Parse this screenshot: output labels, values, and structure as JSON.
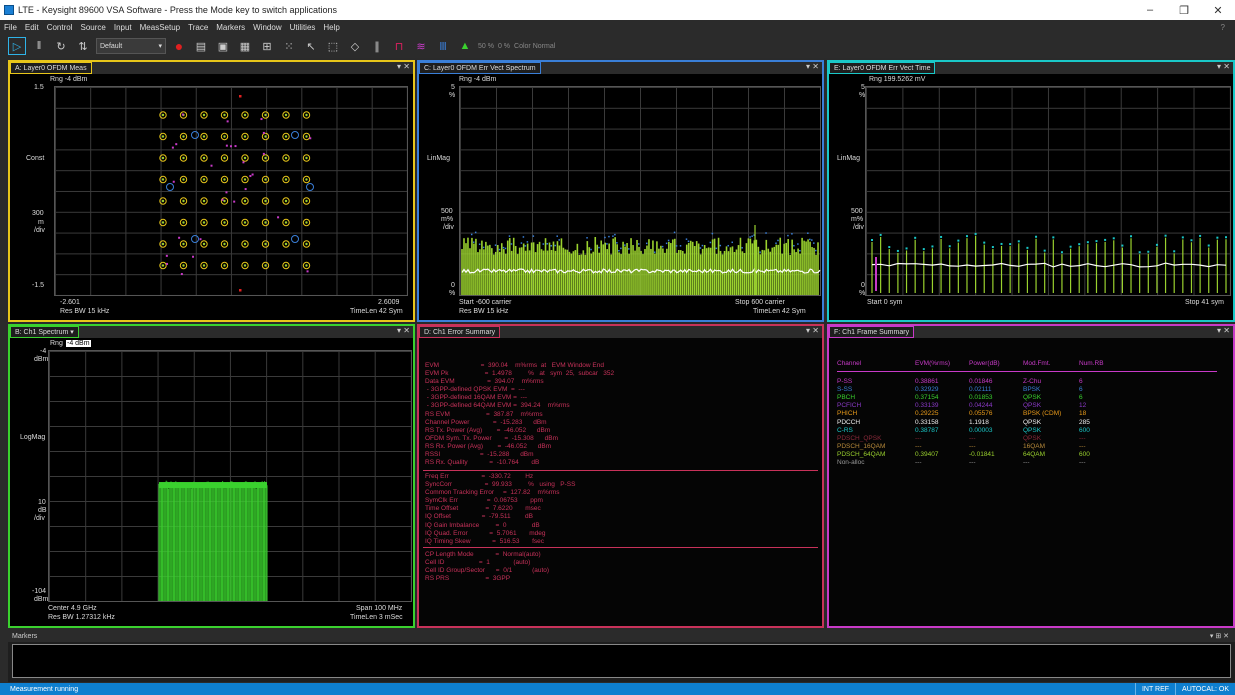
{
  "window": {
    "title": "LTE - Keysight 89600 VSA Software - Press the Mode key to switch applications",
    "minimize": "–",
    "maximize": "❐",
    "close": "✕"
  },
  "menu": [
    "File",
    "Edit",
    "Control",
    "Source",
    "Input",
    "MeasSetup",
    "Trace",
    "Markers",
    "Window",
    "Utilities",
    "Help"
  ],
  "help_mark": "?",
  "toolbar": {
    "preset": "Default",
    "pct1": "50 %",
    "pct2": "0 %",
    "color_mode": "Color Normal"
  },
  "paneA": {
    "title": "A: Layer0 OFDM Meas",
    "rng": "Rng -4 dBm",
    "top": "1.5",
    "mid_label": "Const",
    "scale": [
      "300",
      "m",
      "/div"
    ],
    "bottom": "-1.5",
    "x_start": "-2.601",
    "x_stop": "2.6009",
    "res_bw": "Res BW 15 kHz",
    "timelen": "TimeLen 42  Sym",
    "color": "#e8c61a"
  },
  "paneC": {
    "title": "C: Layer0 OFDM Err Vect Spectrum",
    "rng": "Rng -4 dBm",
    "top": [
      "5",
      "%"
    ],
    "mid_label": "LinMag",
    "scale": [
      "500",
      "m%",
      "/div"
    ],
    "bottom": [
      "0",
      "%"
    ],
    "x_start": "Start -600  carrier",
    "x_stop": "Stop 600  carrier",
    "res_bw": "Res BW 15 kHz",
    "timelen": "TimeLen 42  Sym",
    "color": "#3a7fd8"
  },
  "paneE": {
    "title": "E: Layer0 OFDM Err Vect Time",
    "rng": "Rng 199.5262 mV",
    "top": [
      "5",
      "%"
    ],
    "mid_label": "LinMag",
    "scale": [
      "500",
      "m%",
      "/div"
    ],
    "bottom": [
      "0",
      "%"
    ],
    "x_start": "Start 0  sym",
    "x_stop": "Stop 41  sym",
    "color": "#1ac8c8"
  },
  "paneB": {
    "title": "B: Ch1 Spectrum",
    "rng_prefix": "Rng ",
    "rng_value": "-4 dBm",
    "top": [
      "-4",
      "dBm"
    ],
    "mid_label": "LogMag",
    "scale": [
      "10",
      "dB",
      "/div"
    ],
    "bottom": [
      "-104",
      "dBm"
    ],
    "center": "Center 4.9 GHz",
    "span": "Span 100 MHz",
    "res_bw": "Res BW 1.27312 kHz",
    "timelen": "TimeLen 3 mSec",
    "color": "#3ad12e"
  },
  "paneD": {
    "title": "D: Ch1 Error Summary",
    "color": "#c8325a",
    "lines": [
      "EVM                       =  390.04    m%rms  at   EVM Window End",
      "EVM Pk                    =  1.4978         %   at   sym  25,  subcar   352",
      "Data EVM                  =  394.07    m%rms",
      " - 3GPP-defined QPSK EVM  =  ---",
      " - 3GPP-defined 16QAM EVM =  ---",
      " - 3GPP-defined 64QAM EVM =  394.24    m%rms",
      "RS EVM                    =  387.87    m%rms",
      "Channel Power             =  -15.283      dBm",
      "RS Tx. Power (Avg)        =  -46.052      dBm",
      "OFDM Sym. Tx. Power       =  -15.308      dBm",
      "RS Rx. Power (Avg)        =  -46.052      dBm",
      "RSSI                      =  -15.288      dBm",
      "RS Rx. Quality            =  -10.764       dB"
    ],
    "lines2": [
      "Freq Err                  =  -330.72        Hz",
      "SyncCorr                  =  99.933         %   using   P-SS",
      "Common Tracking Error     =  127.82    m%rms",
      "SymClk Err                =  0.06753       ppm",
      "Time Offset               =  7.6220       msec",
      "IQ Offset                 =  -79.511        dB",
      "IQ Gain Imbalance         =  0              dB",
      "IQ Quad. Error            =  5.7061       mdeg",
      "IQ Timing Skew            =  516.53       fsec"
    ],
    "lines3": [
      "CP Length Mode            =  Normal(auto)",
      "Cell ID                   =  1             (auto)",
      "Cell ID Group/Sector      =  0/1           (auto)",
      "RS PRS                    =  3GPP"
    ]
  },
  "paneF": {
    "title": "F: Ch1 Frame Summary",
    "color": "#c83ac8",
    "headers": [
      "Channel",
      "EVM(%rms)",
      "Power(dB)",
      "Mod.Fmt.",
      "Num.RB"
    ],
    "rows": [
      {
        "c": "P-SS",
        "e": "0.38861",
        "p": "0.01846",
        "m": "Z-Chu",
        "n": "6",
        "col": "#c83ac8"
      },
      {
        "c": "S-SS",
        "e": "0.32929",
        "p": "0.02111",
        "m": "BPSK",
        "n": "6",
        "col": "#3a7fd8"
      },
      {
        "c": "PBCH",
        "e": "0.37154",
        "p": "0.01853",
        "m": "QPSK",
        "n": "6",
        "col": "#3ad12e"
      },
      {
        "c": "PCFICH",
        "e": "0.33139",
        "p": "0.04244",
        "m": "QPSK",
        "n": "12",
        "col": "#8a3ac8"
      },
      {
        "c": "PHICH",
        "e": "0.29225",
        "p": "0.05576",
        "m": "BPSK (CDM)",
        "n": "18",
        "col": "#e89a1a"
      },
      {
        "c": "PDCCH",
        "e": "0.33158",
        "p": "1.1918",
        "m": "QPSK",
        "n": "285",
        "col": "#f0f0f0"
      },
      {
        "c": "C-RS",
        "e": "0.38787",
        "p": "0.00003",
        "m": "QPSK",
        "n": "600",
        "col": "#1ac8c8"
      },
      {
        "c": "PDSCH_QPSK",
        "e": "---",
        "p": "---",
        "m": "QPSK",
        "n": "---",
        "col": "#8a2a3a"
      },
      {
        "c": "PDSCH_16QAM",
        "e": "---",
        "p": "---",
        "m": "16QAM",
        "n": "---",
        "col": "#b88a3a"
      },
      {
        "c": "PDSCH_64QAM",
        "e": "0.39407",
        "p": "-0.01841",
        "m": "64QAM",
        "n": "600",
        "col": "#9ad12e"
      },
      {
        "c": "Non-alloc",
        "e": "---",
        "p": "---",
        "m": "---",
        "n": "---",
        "col": "#999999"
      }
    ]
  },
  "markers": {
    "title": "Markers",
    "ctrl": "▾ ⊞ ✕"
  },
  "status": {
    "text": "Measurement running",
    "int_ref": "INT REF",
    "autocal": "AUTOCAL: OK"
  },
  "pane_ctrl": "▾ ✕"
}
